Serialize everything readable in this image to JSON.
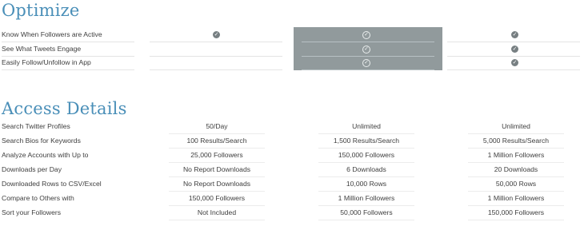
{
  "optimize": {
    "title": "Optimize",
    "rows": [
      {
        "label": "Know When Followers are Active",
        "plans": [
          true,
          true,
          true
        ]
      },
      {
        "label": "See What Tweets Engage",
        "plans": [
          false,
          true,
          true
        ]
      },
      {
        "label": "Easily Follow/Unfollow in App",
        "plans": [
          false,
          true,
          true
        ]
      }
    ],
    "check_icon": "check-circle-icon"
  },
  "access": {
    "title": "Access Details",
    "rows": [
      {
        "label": "Search Twitter Profiles",
        "values": [
          "50/Day",
          "Unlimited",
          "Unlimited"
        ]
      },
      {
        "label": "Search Bios for Keywords",
        "values": [
          "100 Results/Search",
          "1,500 Results/Search",
          "5,000 Results/Search"
        ]
      },
      {
        "label": "Analyze Accounts with Up to",
        "values": [
          "25,000 Followers",
          "150,000 Followers",
          "1 Million Followers"
        ]
      },
      {
        "label": "Downloads per Day",
        "values": [
          "No Report Downloads",
          "6 Downloads",
          "20 Downloads"
        ]
      },
      {
        "label": "Downloaded Rows to CSV/Excel",
        "values": [
          "No Report Downloads",
          "10,000 Rows",
          "50,000 Rows"
        ]
      },
      {
        "label": "Compare to Others with",
        "values": [
          "150,000 Followers",
          "1 Million Followers",
          "1 Million Followers"
        ]
      },
      {
        "label": "Sort your Followers",
        "values": [
          "Not Included",
          "50,000 Followers",
          "150,000 Followers"
        ]
      }
    ]
  },
  "colors": {
    "title": "#4a8fb8",
    "highlight_column": "#919a9c",
    "check": "#777f82"
  }
}
